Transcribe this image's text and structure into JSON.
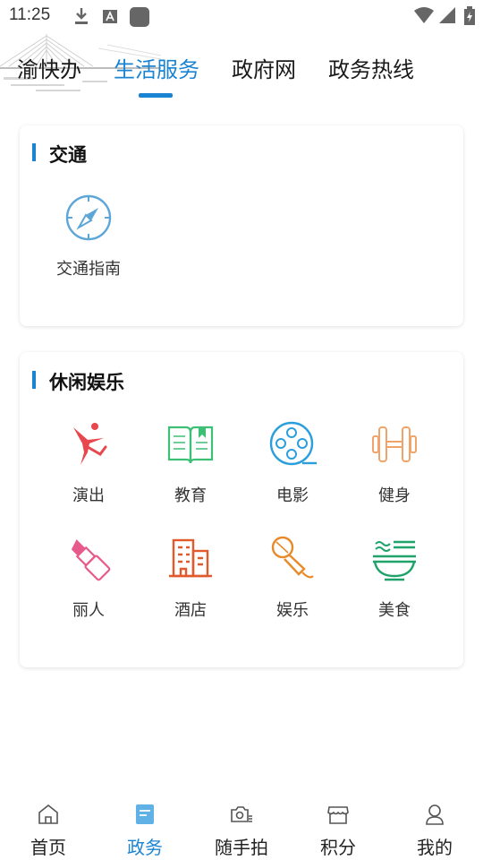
{
  "status_bar": {
    "time": "11:25"
  },
  "header": {
    "tabs": [
      {
        "label": "渝快办"
      },
      {
        "label": "生活服务"
      },
      {
        "label": "政府网"
      },
      {
        "label": "政务热线"
      }
    ],
    "active_tab": "生活服务"
  },
  "transport": {
    "title": "交通",
    "items": [
      {
        "label": "交通指南",
        "icon": "compass-icon"
      }
    ]
  },
  "leisure": {
    "title": "休闲娱乐",
    "items": [
      {
        "label": "演出",
        "icon": "dancer-icon"
      },
      {
        "label": "教育",
        "icon": "book-icon"
      },
      {
        "label": "电影",
        "icon": "film-reel-icon"
      },
      {
        "label": "健身",
        "icon": "dumbbell-icon"
      },
      {
        "label": "丽人",
        "icon": "lipstick-icon"
      },
      {
        "label": "酒店",
        "icon": "hotel-icon"
      },
      {
        "label": "娱乐",
        "icon": "microphone-icon"
      },
      {
        "label": "美食",
        "icon": "noodle-bowl-icon"
      }
    ]
  },
  "bottom_nav": {
    "items": [
      {
        "label": "首页",
        "icon": "home-icon"
      },
      {
        "label": "政务",
        "icon": "document-icon"
      },
      {
        "label": "随手拍",
        "icon": "camera-icon"
      },
      {
        "label": "积分",
        "icon": "shop-icon"
      },
      {
        "label": "我的",
        "icon": "user-icon"
      }
    ],
    "active": "政务"
  },
  "colors": {
    "accent": "#1a84d2",
    "performance": "#e8474d",
    "education": "#3dbf75",
    "movie": "#2a9fdc",
    "fitness": "#f0a46a",
    "beauty": "#e85a8c",
    "hotel": "#e25a2c",
    "entertainment": "#e88a2a",
    "food": "#1fa36b"
  }
}
